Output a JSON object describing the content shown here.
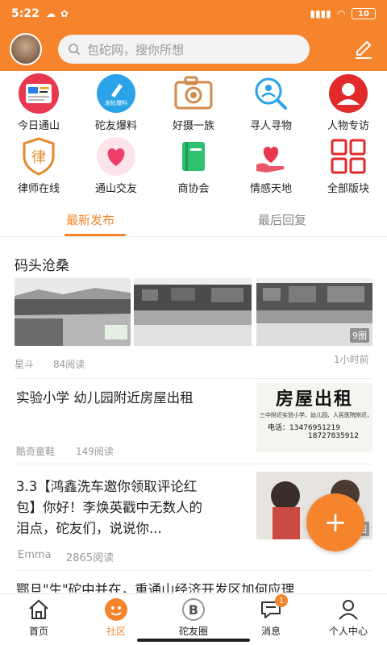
{
  "status_bar": {
    "time": "5:22",
    "battery": "10"
  },
  "header": {
    "search_placeholder": "包砣网，搜你所想"
  },
  "categories": [
    {
      "label": "今日通山",
      "icon": "news-card-icon"
    },
    {
      "label": "砣友爆料",
      "icon": "report-pen-icon",
      "icon_text": "发帖爆料"
    },
    {
      "label": "好摄一族",
      "icon": "camera-icon"
    },
    {
      "label": "寻人寻物",
      "icon": "search-person-icon"
    },
    {
      "label": "人物专访",
      "icon": "person-interview-icon"
    },
    {
      "label": "律师在线",
      "icon": "law-shield-icon",
      "icon_text": "律"
    },
    {
      "label": "通山交友",
      "icon": "heart-icon"
    },
    {
      "label": "商协会",
      "icon": "book-icon"
    },
    {
      "label": "情感天地",
      "icon": "heart-hand-icon"
    },
    {
      "label": "全部版块",
      "icon": "all-blocks-grid-icon"
    }
  ],
  "tabs": [
    {
      "label": "最新发布",
      "active": true
    },
    {
      "label": "最后回复",
      "active": false
    }
  ],
  "posts": [
    {
      "title": "码头沧桑",
      "author": "星斗",
      "reads": "84阅读",
      "time": "1小时前",
      "image_count": "9图"
    },
    {
      "title": "实验小学  幼儿园附近房屋出租",
      "author": "酷奇童鞋",
      "reads": "149阅读",
      "thumb_text": {
        "heading": "房屋出租",
        "line1": "三中附近实验小学、幼儿园、人民医院附近，",
        "phone1": "电话：13476951219",
        "phone2": "18727835912"
      }
    },
    {
      "title_lines": [
        "3.3【鸿鑫洗车邀你领取评论红",
        "包】你好！李焕英戳中无数人的",
        "泪点，砣友们，说说你..."
      ],
      "author": "Emma",
      "reads": "2865阅读",
      "image_count": "图"
    },
    {
      "title_partial": "鄂旦\"生\"砣中并在，重通山经济开发区加何应理"
    }
  ],
  "fab": {
    "label": "+"
  },
  "bottom_nav": [
    {
      "label": "首页",
      "icon": "home-icon",
      "active": false
    },
    {
      "label": "社区",
      "icon": "community-icon",
      "active": true
    },
    {
      "label": "砣友圈",
      "icon": "friends-circle-icon",
      "active": false
    },
    {
      "label": "消息",
      "icon": "message-icon",
      "active": false,
      "badge": "1"
    },
    {
      "label": "个人中心",
      "icon": "profile-icon",
      "active": false
    }
  ],
  "colors": {
    "brand": "#f5842c"
  }
}
